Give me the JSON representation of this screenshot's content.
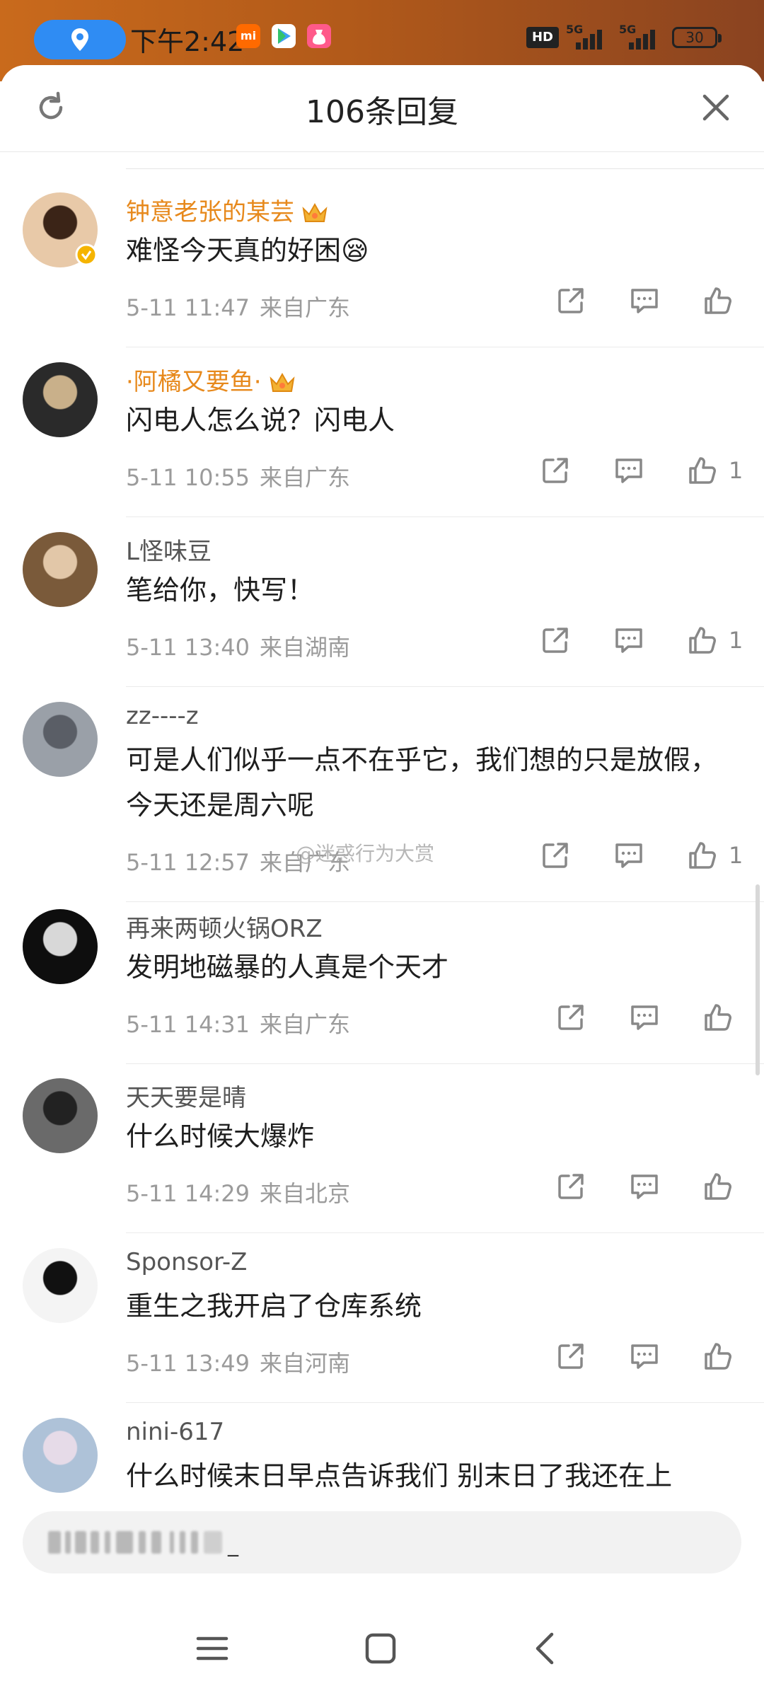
{
  "status_bar": {
    "time": "下午2:42",
    "network_1": "5G",
    "network_2": "5G",
    "hd_label": "HD",
    "battery": "30"
  },
  "header": {
    "title": "106条回复"
  },
  "comments": [
    {
      "user": "钟意老张的某芸",
      "vip": true,
      "text": "难怪今天真的好困😪",
      "date": "5-11 11:47",
      "location": "来自广东",
      "likes": ""
    },
    {
      "user": "·阿橘又要鱼·",
      "vip": true,
      "text": "闪电人怎么说？闪电人",
      "date": "5-11 10:55",
      "location": "来自广东",
      "likes": "1"
    },
    {
      "user": "L怪味豆",
      "vip": false,
      "text": "笔给你，快写！",
      "date": "5-11 13:40",
      "location": "来自湖南",
      "likes": "1"
    },
    {
      "user": "zz----z",
      "vip": false,
      "text": "可是人们似乎一点不在乎它，我们想的只是放假，今天还是周六呢",
      "date": "5-11 12:57",
      "location": "来自广东",
      "likes": "1"
    },
    {
      "user": "再来两顿火锅ORZ",
      "vip": false,
      "text": "发明地磁暴的人真是个天才",
      "date": "5-11 14:31",
      "location": "来自广东",
      "likes": ""
    },
    {
      "user": "天天要是晴",
      "vip": false,
      "text": "什么时候大爆炸",
      "date": "5-11 14:29",
      "location": "来自北京",
      "likes": ""
    },
    {
      "user": "Sponsor-Z",
      "vip": false,
      "text": "重生之我开启了仓库系统",
      "date": "5-11 13:49",
      "location": "来自河南",
      "likes": ""
    },
    {
      "user": "nini-617",
      "vip": false,
      "text": "什么时候末日早点告诉我们 别末日了我还在上",
      "date": "",
      "location": "",
      "likes": ""
    }
  ],
  "watermark": "@迷惑行为大赏",
  "input": {
    "cursor": "_"
  },
  "colors": {
    "status_bar": "#b85f1c",
    "vip_name": "#e7891c",
    "meta": "#9b9b9b"
  }
}
